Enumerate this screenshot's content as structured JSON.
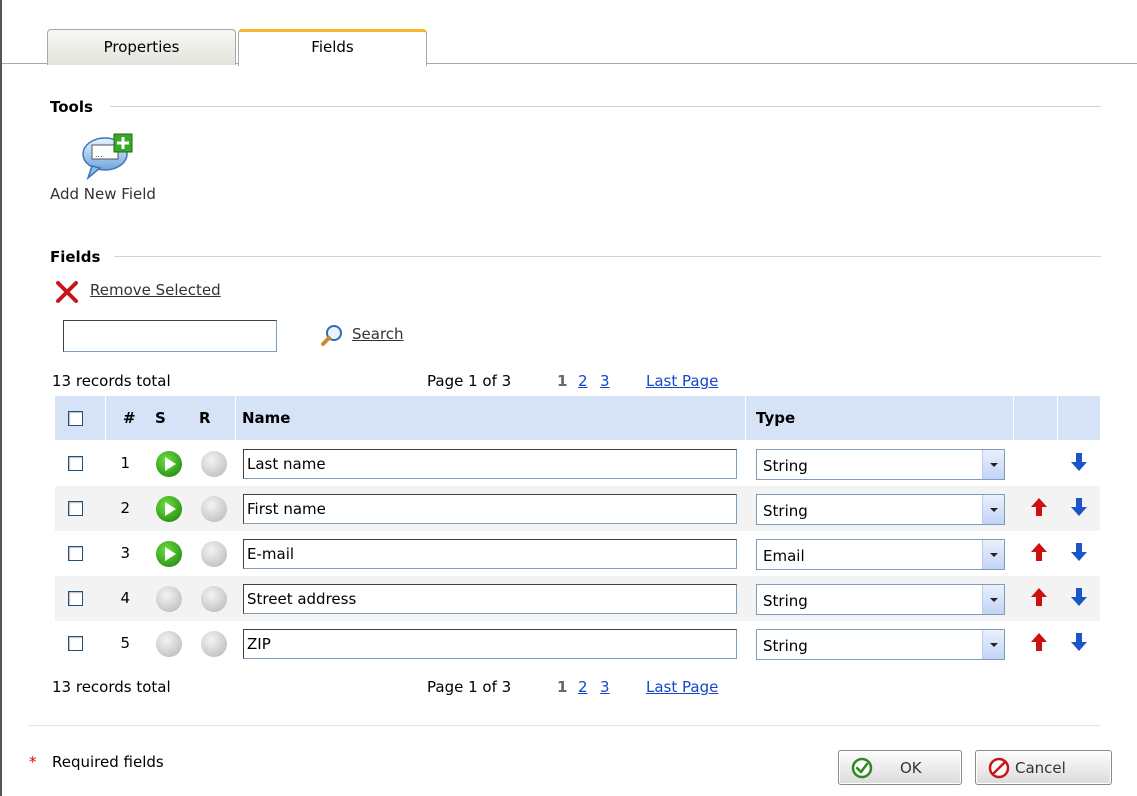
{
  "tabs": [
    {
      "label": "Properties",
      "active": false
    },
    {
      "label": "Fields",
      "active": true
    }
  ],
  "tools": {
    "title": "Tools",
    "add_new_field_label": "Add New Field"
  },
  "fields_section": {
    "title": "Fields",
    "remove_selected_label": "Remove Selected",
    "search": {
      "value": "",
      "button_label": "Search"
    }
  },
  "paging": {
    "records_total": "13 records total",
    "page_info": "Page 1 of 3",
    "pages": [
      "1",
      "2",
      "3"
    ],
    "current_page": "1",
    "last_page_label": "Last Page"
  },
  "table": {
    "headers": {
      "num": "#",
      "s": "S",
      "r": "R",
      "name": "Name",
      "type": "Type"
    },
    "rows": [
      {
        "num": "1",
        "s": "green",
        "r": "gray",
        "name": "Last name",
        "type": "String",
        "up": false,
        "down": true
      },
      {
        "num": "2",
        "s": "green",
        "r": "gray",
        "name": "First name",
        "type": "String",
        "up": true,
        "down": true
      },
      {
        "num": "3",
        "s": "green",
        "r": "gray",
        "name": "E-mail",
        "type": "Email",
        "up": true,
        "down": true
      },
      {
        "num": "4",
        "s": "gray",
        "r": "gray",
        "name": "Street address",
        "type": "String",
        "up": true,
        "down": true
      },
      {
        "num": "5",
        "s": "gray",
        "r": "gray",
        "name": "ZIP",
        "type": "String",
        "up": true,
        "down": true
      }
    ]
  },
  "footer": {
    "required_star": "*",
    "required_label": "Required fields",
    "ok_label": "OK",
    "cancel_label": "Cancel"
  },
  "colors": {
    "tab_active_accent": "#f5b92e",
    "grid_header_bg": "#d6e2f6",
    "link": "#1346c9",
    "up_arrow": "#cc1111",
    "down_arrow": "#1a56c9",
    "status_on": "#2f9a1a",
    "status_off": "#c7c7c7"
  },
  "icons": {
    "add_field": "add-field-icon",
    "remove": "remove-x-icon",
    "search": "magnifier-icon",
    "move_up": "arrow-up-icon",
    "move_down": "arrow-down-icon",
    "ok": "check-circle-icon",
    "cancel": "prohibit-circle-icon"
  }
}
